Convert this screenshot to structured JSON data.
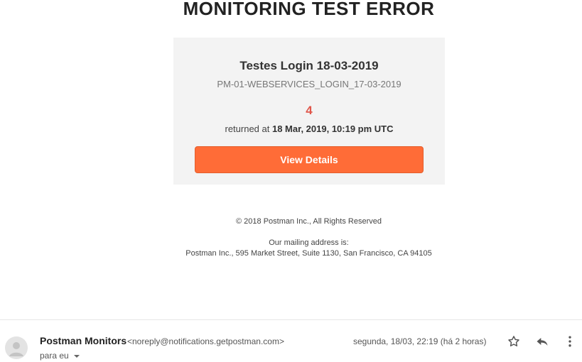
{
  "email": {
    "heading": "MONITORING TEST ERROR",
    "card": {
      "title": "Testes Login 18-03-2019",
      "monitor_id": "PM-01-WEBSERVICES_LOGIN_17-03-2019",
      "count": "4",
      "returned_prefix": "returned at",
      "returned_time": "18 Mar, 2019, 10:19 pm UTC",
      "button_label": "View Details"
    },
    "footer": {
      "copyright": "© 2018 Postman Inc., All Rights Reserved",
      "mailing_label": "Our mailing address is:",
      "mailing_address": "Postman Inc., 595 Market Street, Suite 1130, San Francisco, CA 94105"
    }
  },
  "message_header": {
    "sender_name": "Postman Monitors",
    "sender_email": "<noreply@notifications.getpostman.com>",
    "recipient": "para eu",
    "date": "segunda, 18/03, 22:19 (há 2 horas)",
    "icons": [
      "avatar-icon",
      "chevron-down-icon",
      "star-icon",
      "reply-icon",
      "more-vert-icon"
    ]
  },
  "colors": {
    "accent": "#ff6c37",
    "error_count": "#e0564a",
    "card_bg": "#f3f3f3"
  }
}
